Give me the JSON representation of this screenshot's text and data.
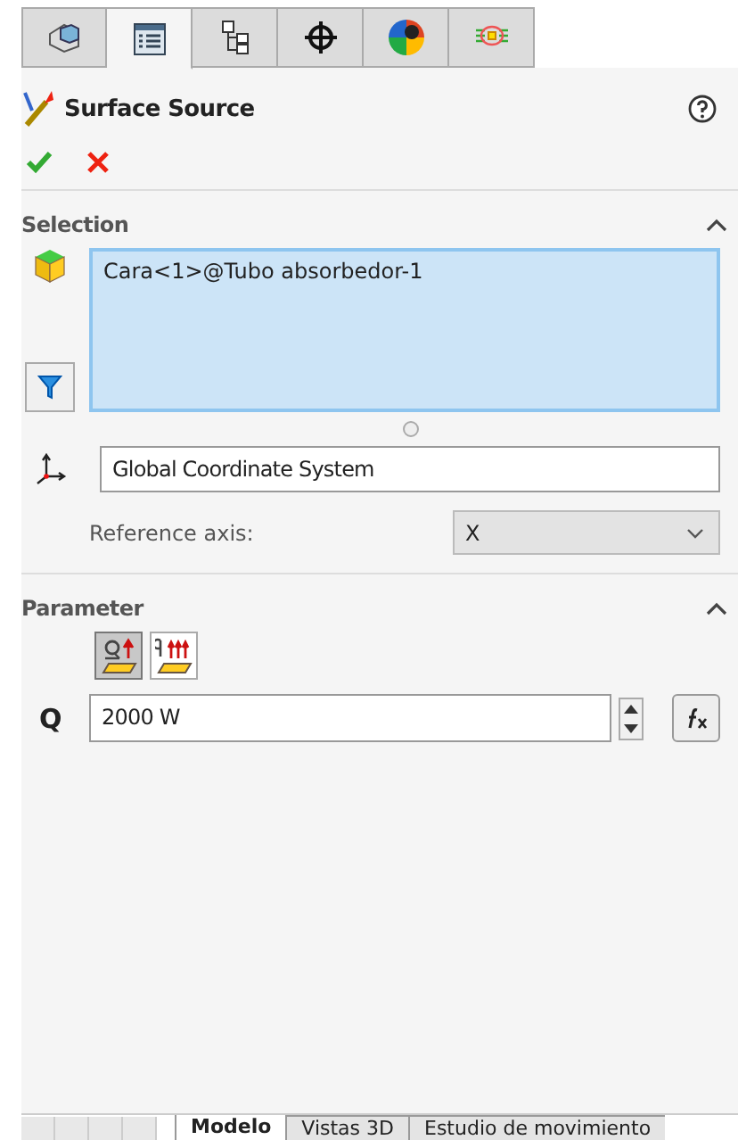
{
  "tabs": [
    {
      "kind": "feature",
      "selected": false
    },
    {
      "kind": "property",
      "selected": true
    },
    {
      "kind": "config",
      "selected": false
    },
    {
      "kind": "dimxpert",
      "selected": false
    },
    {
      "kind": "display",
      "selected": false
    },
    {
      "kind": "flow",
      "selected": false
    }
  ],
  "title": "Surface Source",
  "selection": {
    "header": "Selection",
    "expanded": true,
    "faces": [
      "Cara<1>@Tubo absorbedor-1"
    ],
    "coordinate_system": "Global Coordinate System",
    "reference_axis_label": "Reference axis:",
    "reference_axis": "X"
  },
  "parameter": {
    "header": "Parameter",
    "expanded": true,
    "modes": [
      {
        "kind": "total",
        "selected": true
      },
      {
        "kind": "flux",
        "selected": false
      }
    ],
    "symbol": "Q",
    "value": "2000 W"
  },
  "bottom_tabs": [
    {
      "label": "Modelo",
      "selected": true
    },
    {
      "label": "Vistas 3D",
      "selected": false
    },
    {
      "label": "Estudio de movimiento",
      "selected": false
    }
  ]
}
